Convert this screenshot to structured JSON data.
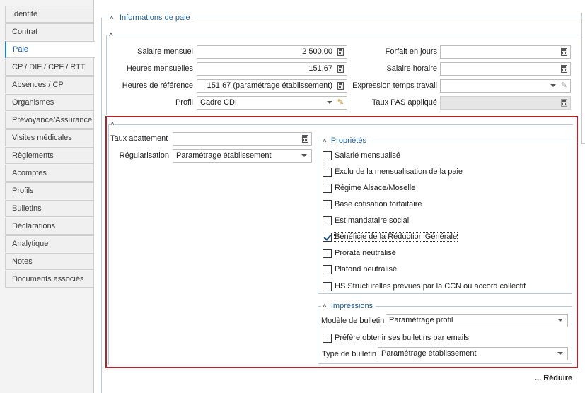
{
  "sidebar": {
    "items": [
      {
        "label": "Identité"
      },
      {
        "label": "Contrat"
      },
      {
        "label": "Paie"
      },
      {
        "label": "CP / DIF / CPF / RTT"
      },
      {
        "label": "Absences / CP"
      },
      {
        "label": "Organismes"
      },
      {
        "label": "Prévoyance/Assurance"
      },
      {
        "label": "Visites médicales"
      },
      {
        "label": "Règlements"
      },
      {
        "label": "Acomptes"
      },
      {
        "label": "Profils"
      },
      {
        "label": "Bulletins"
      },
      {
        "label": "Déclarations"
      },
      {
        "label": "Analytique"
      },
      {
        "label": "Notes"
      },
      {
        "label": "Documents associés"
      }
    ],
    "active_index": 2
  },
  "main": {
    "section_title": "Informations de paie",
    "salaire_mensuel": {
      "label": "Salaire mensuel",
      "value": "2 500,00"
    },
    "heures_mensuelles": {
      "label": "Heures mensuelles",
      "value": "151,67"
    },
    "heures_reference": {
      "label": "Heures de référence",
      "value": "151,67 (paramétrage établissement)"
    },
    "profil": {
      "label": "Profil",
      "value": "Cadre CDI"
    },
    "forfait_jours": {
      "label": "Forfait en jours",
      "value": ""
    },
    "salaire_horaire": {
      "label": "Salaire horaire",
      "value": ""
    },
    "expression_temps": {
      "label": "Expression temps travail",
      "value": ""
    },
    "taux_pas": {
      "label": "Taux PAS appliqué",
      "value": ""
    },
    "taux_abattement": {
      "label": "Taux abattement",
      "value": ""
    },
    "regularisation": {
      "label": "Régularisation",
      "value": "Paramétrage établissement"
    },
    "proprietes": {
      "title": "Propriétés",
      "items": [
        {
          "label": "Salarié mensualisé",
          "checked": false
        },
        {
          "label": "Exclu de la mensualisation de la paie",
          "checked": false
        },
        {
          "label": "Régime Alsace/Moselle",
          "checked": false
        },
        {
          "label": "Base cotisation forfaitaire",
          "checked": false
        },
        {
          "label": "Est mandataire social",
          "checked": false
        },
        {
          "label": "Bénéficie de la Réduction Générale",
          "checked": true
        },
        {
          "label": "Prorata neutralisé",
          "checked": false
        },
        {
          "label": "Plafond neutralisé",
          "checked": false
        },
        {
          "label": "HS Structurelles prévues par la CCN ou accord collectif",
          "checked": false
        }
      ]
    },
    "impressions": {
      "title": "Impressions",
      "modele_label": "Modèle de bulletin",
      "modele_value": "Paramétrage profil",
      "emails_label": "Préfère obtenir ses bulletins par emails",
      "emails_checked": false,
      "type_label": "Type de bulletin",
      "type_value": "Paramétrage établissement"
    },
    "reduire_label": "... Réduire"
  }
}
